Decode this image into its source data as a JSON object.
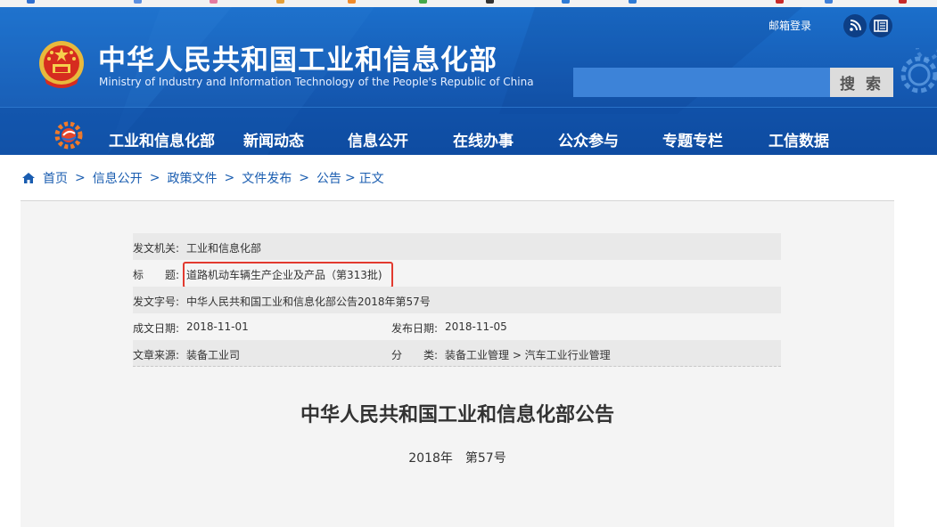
{
  "header": {
    "title": "中华人民共和国工业和信息化部",
    "subtitle": "Ministry of Industry and Information Technology of the People's Republic of China",
    "mail_login": "邮箱登录",
    "search_placeholder": "",
    "search_button": "搜 索"
  },
  "nav": {
    "items": [
      "工业和信息化部",
      "新闻动态",
      "信息公开",
      "在线办事",
      "公众参与",
      "专题专栏",
      "工信数据"
    ]
  },
  "breadcrumb": {
    "items": [
      "首页",
      "信息公开",
      "政策文件",
      "文件发布",
      "公告",
      "正文"
    ],
    "separator": ">"
  },
  "meta": {
    "issuer_label": "发文机关:",
    "issuer": "工业和信息化部",
    "title_label": "标　　题:",
    "title": "道路机动车辆生产企业及产品（第313批)",
    "doc_number_label": "发文字号:",
    "doc_number": "中华人民共和国工业和信息化部公告2018年第57号",
    "written_date_label": "成文日期:",
    "written_date": "2018-11-01",
    "publish_date_label": "发布日期:",
    "publish_date": "2018-11-05",
    "source_label": "文章来源:",
    "source": "装备工业司",
    "category_label": "分　　类:",
    "category": "装备工业管理 > 汽车工业行业管理"
  },
  "document": {
    "title": "中华人民共和国工业和信息化部公告",
    "number": "2018年　第57号"
  },
  "colors": {
    "header_blue": "#1559b2",
    "highlight_red": "#e23a2f",
    "link_blue": "#1a5db0"
  },
  "icons": [
    "national-emblem-icon",
    "rss-icon",
    "book-icon",
    "gear-icon",
    "home-icon",
    "miit-logo-icon"
  ]
}
